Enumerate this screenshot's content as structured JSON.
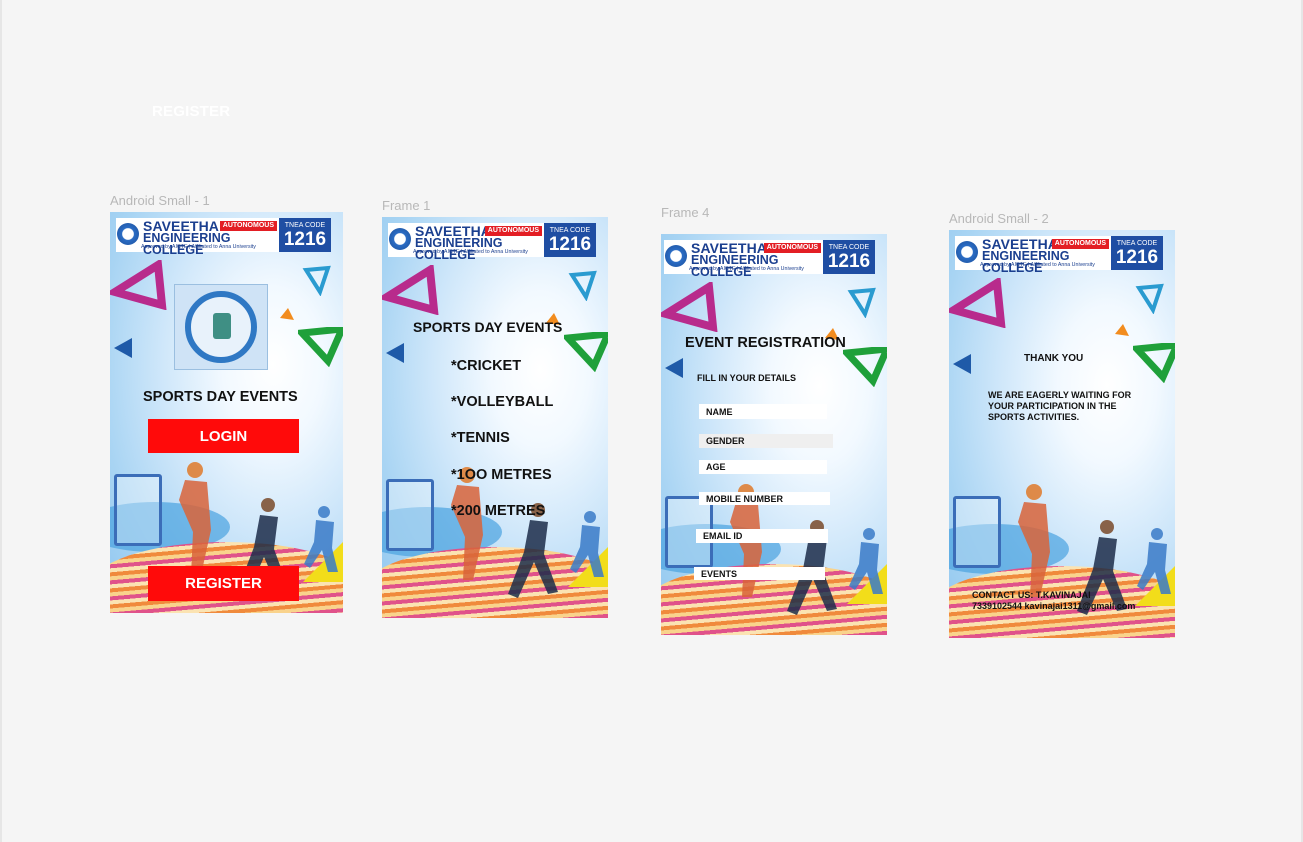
{
  "canvas": {
    "ghost_label": "REGISTER"
  },
  "header": {
    "name_line1": "SAVEETHA",
    "autonomous": "AUTONOMOUS",
    "name_line2": "ENGINEERING COLLEGE",
    "approval": "Approved by AICTE  |  Affiliated to Anna University",
    "tnea_label": "TNEA CODE",
    "tnea_code": "1216"
  },
  "frames": [
    {
      "label": "Android Small - 1",
      "title": "SPORTS DAY EVENTS",
      "login_label": "LOGIN",
      "register_label": "REGISTER"
    },
    {
      "label": "Frame 1",
      "title": "SPORTS DAY EVENTS",
      "events": [
        "*CRICKET",
        "*VOLLEYBALL",
        "*TENNIS",
        "*1OO METRES",
        "*200 METRES"
      ]
    },
    {
      "label": "Frame 4",
      "title": "EVENT REGISTRATION",
      "subtitle": "FILL IN YOUR DETAILS",
      "fields": [
        "NAME",
        "GENDER",
        "AGE",
        "MOBILE NUMBER",
        "EMAIL ID",
        "EVENTS"
      ]
    },
    {
      "label": "Android Small - 2",
      "thank_you": "THANK YOU",
      "message": "WE ARE EAGERLY WAITING FOR YOUR PARTICIPATION IN THE SPORTS ACTIVITIES.",
      "contact_line1": "CONTACT US: T.KAVINAJAI",
      "contact_line2": "7339102544 kavinajai1311@gmail.com"
    }
  ],
  "colors": {
    "button_red": "#ff0a0a",
    "header_blue": "#1f4ea3",
    "autonomous_red": "#e31e24",
    "frame_label_gray": "#b8b8b8"
  },
  "icons": [
    "college-seal-icon",
    "university-emblem-icon",
    "triangle-decoration-icon",
    "athlete-silhouette-icon"
  ]
}
